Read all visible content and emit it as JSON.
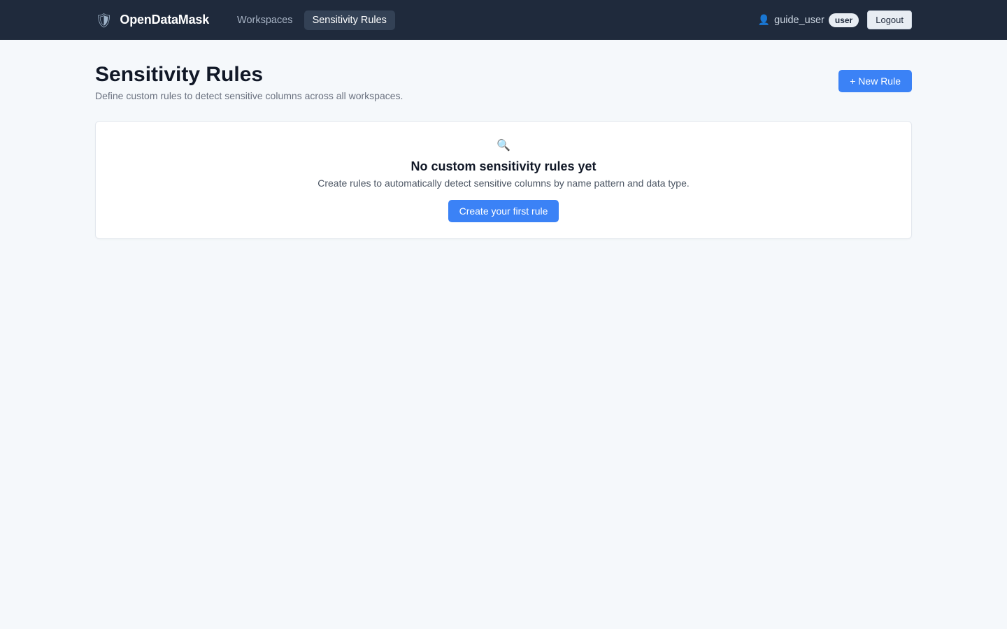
{
  "header": {
    "brand_icon": "shield-icon",
    "brand_name": "OpenDataMask",
    "nav": [
      {
        "label": "Workspaces",
        "active": false
      },
      {
        "label": "Sensitivity Rules",
        "active": true
      }
    ],
    "user_icon": "user-icon",
    "username": "guide_user",
    "role": "user",
    "logout_label": "Logout"
  },
  "page": {
    "title": "Sensitivity Rules",
    "subtitle": "Define custom rules to detect sensitive columns across all workspaces.",
    "new_rule_label": "+ New Rule"
  },
  "empty_state": {
    "icon": "search-icon",
    "title": "No custom sensitivity rules yet",
    "text": "Create rules to automatically detect sensitive columns by name pattern and data type.",
    "cta_label": "Create your first rule"
  },
  "colors": {
    "topbar": "#1f2a3c",
    "accent": "#3b82f6",
    "background": "#f5f8fb"
  }
}
